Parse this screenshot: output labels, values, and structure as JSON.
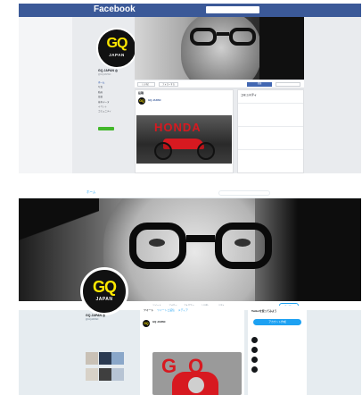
{
  "facebook": {
    "logo": "Facebook",
    "search_placeholder": "",
    "top_nav": "",
    "page": {
      "name": "GQ JAPAN ◎",
      "handle": "@GQJAPAN",
      "nav": [
        "ホーム",
        "写真",
        "動画",
        "投稿",
        "基本データ",
        "イベント",
        "コミュニティ"
      ],
      "cta_label": ""
    },
    "actions": {
      "like": "いいね！",
      "follow": "フォローする",
      "signup": "登録",
      "message": ""
    },
    "post": {
      "section_label": "投稿",
      "author": "GQ JAPAN",
      "time": "",
      "text": "",
      "image_brand": "HONDA",
      "caption": ""
    },
    "sidebar": {
      "about_title": "コミュニティ",
      "likes": "",
      "blocks": [
        "",
        "",
        ""
      ]
    }
  },
  "twitter": {
    "nav": {
      "home": "ホーム",
      "search_placeholder": "",
      "login": ""
    },
    "profile": {
      "name": "GQ JAPAN ◎",
      "handle": "@GQJAPAN",
      "bio": "",
      "meta": "",
      "link": "",
      "media_header": ""
    },
    "stats": [
      {
        "label": "ツイート",
        "value": ""
      },
      {
        "label": "フォロー",
        "value": ""
      },
      {
        "label": "フォロワー",
        "value": ""
      },
      {
        "label": "いいね",
        "value": ""
      },
      {
        "label": "リスト",
        "value": ""
      }
    ],
    "follow_label": "フォロー",
    "timeline": {
      "tabs": [
        "ツイート",
        "ツイートと返信",
        "メディア"
      ],
      "pinned": "",
      "author": "GQ JAPAN",
      "text": "",
      "link": "",
      "image_text_1": "G",
      "image_text_2": "Q"
    },
    "signup_box": {
      "title": "Twitterを使ってみよう",
      "subtitle": "",
      "signup_label": "アカウント作成",
      "suggest_title": ""
    },
    "suggestions": [
      {
        "name": "",
        "handle": ""
      },
      {
        "name": "",
        "handle": ""
      },
      {
        "name": "",
        "handle": ""
      },
      {
        "name": "",
        "handle": ""
      }
    ]
  },
  "brand": {
    "logo_main": "GQ",
    "logo_sub": "JAPAN",
    "logo_color": "#ffe800",
    "facebook_blue": "#3b5998",
    "twitter_blue": "#1da1f2",
    "honda_red": "#d71920"
  }
}
